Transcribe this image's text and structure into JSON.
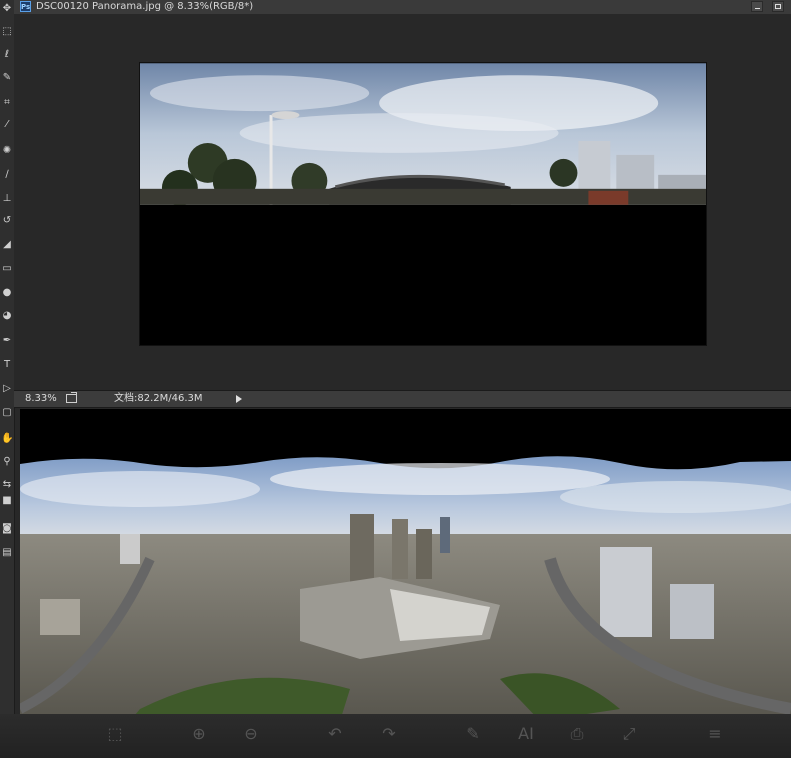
{
  "document": {
    "title": "DSC00120 Panorama.jpg @ 8.33%(RGB/8*)",
    "app_badge": "Ps"
  },
  "statusbar": {
    "zoom": "8.33%",
    "doc_size": "文档:82.2M/46.3M"
  },
  "tools": [
    {
      "name": "move-tool-icon",
      "glyph": "✥"
    },
    {
      "name": "marquee-tool-icon",
      "glyph": "⬚"
    },
    {
      "name": "lasso-tool-icon",
      "glyph": "ℓ"
    },
    {
      "name": "quick-select-tool-icon",
      "glyph": "✎"
    },
    {
      "name": "crop-tool-icon",
      "glyph": "⌗"
    },
    {
      "name": "eyedropper-tool-icon",
      "glyph": "⁄"
    },
    {
      "name": "healing-brush-tool-icon",
      "glyph": "✺"
    },
    {
      "name": "brush-tool-icon",
      "glyph": "∕"
    },
    {
      "name": "clone-stamp-tool-icon",
      "glyph": "⊥"
    },
    {
      "name": "history-brush-tool-icon",
      "glyph": "↺"
    },
    {
      "name": "eraser-tool-icon",
      "glyph": "◢"
    },
    {
      "name": "gradient-tool-icon",
      "glyph": "▭"
    },
    {
      "name": "blur-tool-icon",
      "glyph": "●"
    },
    {
      "name": "dodge-tool-icon",
      "glyph": "◕"
    },
    {
      "name": "pen-tool-icon",
      "glyph": "✒"
    },
    {
      "name": "type-tool-icon",
      "glyph": "T"
    },
    {
      "name": "path-select-tool-icon",
      "glyph": "▷"
    },
    {
      "name": "shape-tool-icon",
      "glyph": "▢"
    },
    {
      "name": "hand-tool-icon",
      "glyph": "✋"
    },
    {
      "name": "zoom-tool-icon",
      "glyph": "⚲"
    },
    {
      "name": "swap-colors-icon",
      "glyph": "⇆"
    },
    {
      "name": "color-swatch-icon",
      "glyph": "■"
    },
    {
      "name": "quick-mask-icon",
      "glyph": "◙"
    },
    {
      "name": "screen-mode-icon",
      "glyph": "▤"
    }
  ],
  "viewer_toolbar": [
    {
      "name": "fit-icon",
      "glyph": "⬚"
    },
    {
      "name": "zoom-in-icon",
      "glyph": "⊕"
    },
    {
      "name": "zoom-out-icon",
      "glyph": "⊖"
    },
    {
      "name": "rotate-left-icon",
      "glyph": "↶"
    },
    {
      "name": "rotate-right-icon",
      "glyph": "↷"
    },
    {
      "name": "edit-icon",
      "glyph": "✎"
    },
    {
      "name": "ai-icon",
      "glyph": "AI"
    },
    {
      "name": "print-icon",
      "glyph": "⎙"
    },
    {
      "name": "fullscreen-icon",
      "glyph": "⤢"
    },
    {
      "name": "menu-icon",
      "glyph": "≡"
    }
  ],
  "colors": {
    "sky": "#9fb3cc",
    "cloud": "#e4e9f0",
    "ground": "#5c5a52",
    "accent": "#5aa0e8"
  }
}
